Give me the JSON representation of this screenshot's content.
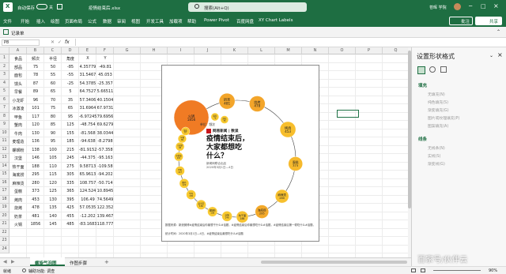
{
  "title_bar": {
    "autosave_label": "自动保存",
    "autosave_state": "关",
    "filename": "疫情结束后.xlsx",
    "search_placeholder": "搜索(Alt+Q)",
    "user_name": "苍晖 学院"
  },
  "menu": [
    "文件",
    "开始",
    "插入",
    "绘图",
    "页面布局",
    "公式",
    "数据",
    "审阅",
    "视图",
    "开发工具",
    "加载项",
    "帮助",
    "Power Pivot",
    "百度网盘",
    "XY Chart Labels"
  ],
  "menu_right": {
    "comments": "批注",
    "share": "共享"
  },
  "ribbon": {
    "first_item": "记录单"
  },
  "formula_bar": {
    "name_box": "P8",
    "fx": "fx",
    "value": ""
  },
  "columns": [
    "A",
    "B",
    "C",
    "D",
    "E",
    "F",
    "G",
    "H",
    "I",
    "J",
    "K",
    "L",
    "M",
    "N",
    "O",
    "P",
    "Q",
    "R"
  ],
  "sheet": {
    "header": [
      "食品",
      "频次",
      "半径",
      "角度",
      "X",
      "Y"
    ],
    "rows": [
      [
        "部品",
        "75",
        "50",
        "-85",
        "4.35779",
        "-49.81"
      ],
      [
        "面包",
        "78",
        "55",
        "-55",
        "31.5467",
        "45.053"
      ],
      [
        "馒头",
        "87",
        "60",
        "-25",
        "54.3785",
        "-25.357"
      ],
      [
        "早餐",
        "89",
        "65",
        "5",
        "64.7527",
        "5.66511"
      ],
      [
        "小龙虾",
        "96",
        "70",
        "35",
        "57.3406",
        "40.1504"
      ],
      [
        "冰激凌",
        "101",
        "75",
        "65",
        "31.6964",
        "67.9731"
      ],
      [
        "甲鱼",
        "117",
        "80",
        "95",
        "-6.97245",
        "79.6956"
      ],
      [
        "蟹肉",
        "120",
        "85",
        "125",
        "-48.754",
        "69.6279"
      ],
      [
        "牛肉",
        "130",
        "90",
        "155",
        "-81.568",
        "38.0344"
      ],
      [
        "麦理造",
        "136",
        "95",
        "185",
        "-94.638",
        "-8.2798"
      ],
      [
        "螺蛳粉",
        "138",
        "100",
        "215",
        "-81.9152",
        "-57.358"
      ],
      [
        "汉堡",
        "146",
        "105",
        "245",
        "-44.375",
        "-95.163"
      ],
      [
        "热干面",
        "188",
        "110",
        "275",
        "9.58713",
        "-109.58"
      ],
      [
        "海底捞",
        "295",
        "115",
        "305",
        "65.9613",
        "-94.202"
      ],
      [
        "麻辣烫",
        "280",
        "120",
        "335",
        "108.757",
        "-50.714"
      ],
      [
        "蛋糕",
        "373",
        "125",
        "365",
        "124.524",
        "10.8945"
      ],
      [
        "烤肉",
        "453",
        "130",
        "395",
        "106.49",
        "74.5649"
      ],
      [
        "烧烤",
        "478",
        "135",
        "425",
        "57.0535",
        "122.352"
      ],
      [
        "奶茶",
        "481",
        "140",
        "455",
        "-12.202",
        "139.467"
      ],
      [
        "火锅",
        "1856",
        "145",
        "485",
        "-83.1683",
        "118.777"
      ]
    ]
  },
  "chart": {
    "brand": "网易新闻 | 数读",
    "headline_lines": [
      "疫情结束后，",
      "大家都想吃",
      "什么？"
    ],
    "byline": "新闻网联合出品",
    "date": "2020年3月1日—4日",
    "unit_label": "单位：频次",
    "bubbles": [
      {
        "name": "火锅",
        "value": "1856",
        "color": "#f07b24"
      },
      {
        "name": "奶茶",
        "value": "481",
        "color": "#f3a52a"
      },
      {
        "name": "烧烤",
        "value": "478",
        "color": "#f3a52a"
      },
      {
        "name": "烤肉",
        "value": "453",
        "color": "#f7be2c"
      },
      {
        "name": "蛋糕",
        "value": "373",
        "color": "#f6b92c"
      },
      {
        "name": "麻辣烫",
        "value": "280",
        "color": "#f7c02e"
      },
      {
        "name": "海底捞",
        "value": "295",
        "color": "#f3a92a"
      },
      {
        "name": "热干面",
        "value": "188",
        "color": "#f7c22e"
      },
      {
        "name": "汉堡",
        "value": "146",
        "color": "#f8c92f"
      },
      {
        "name": "螺蛳粉",
        "value": "138",
        "color": "#f8c92f"
      },
      {
        "name": "麦当劳",
        "value": "136",
        "color": "#f8c92f"
      },
      {
        "name": "牛肉",
        "value": "130",
        "color": "#f8c92f"
      },
      {
        "name": "蟹肉",
        "value": "120",
        "color": "#f8c92f"
      },
      {
        "name": "甲鱼",
        "value": "117",
        "color": "#f8c92f"
      },
      {
        "name": "冰激凌",
        "value": "101",
        "color": "#f8c92f"
      },
      {
        "name": "小龙虾",
        "value": "96",
        "color": "#f8c92f"
      },
      {
        "name": "早餐",
        "value": "89",
        "color": "#f8c92f"
      },
      {
        "name": "馒头",
        "value": "87",
        "color": "#f8c92f"
      },
      {
        "name": "面包",
        "value": "78",
        "color": "#f8c92f"
      },
      {
        "name": "部品",
        "value": "75",
        "color": "#f8c92f"
      }
    ],
    "footnote_lines": [
      "数据来源：新浪微博#疫情结束后你最想干什么#话题，#疫情结束后你最想吃什么#话题，#疫情结束后第一顿吃什么#话题，",
      "统计时间：2020年3月1日—4日，#疫情结束后最想吃什么#话题"
    ]
  },
  "panel": {
    "title": "设置形状格式",
    "section1": "填充",
    "fill_options": [
      "无填充(N)",
      "纯色填充(S)",
      "渐变填充(G)",
      "图片或纹理填充(P)",
      "图案填充(A)"
    ],
    "section2": "线条",
    "line_options": [
      "无线条(N)",
      "实线(S)",
      "渐变线(G)"
    ]
  },
  "sheet_tabs": [
    "螺旋气泡图",
    "作图步骤"
  ],
  "add_sheet": "+",
  "status": {
    "left": "就绪",
    "accessibility": "辅助功能: 调查",
    "zoom": "90%"
  },
  "watermark": "百家号/伙伴云"
}
